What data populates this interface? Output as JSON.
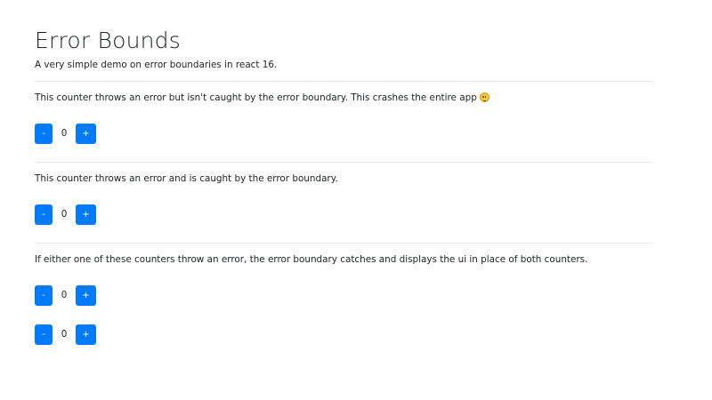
{
  "page": {
    "title": "Error Bounds",
    "subtitle": "A very simple demo on error boundaries in react 16."
  },
  "sections": [
    {
      "text": "This counter throws an error but isn't caught by the error boundary. This crashes the entire app",
      "emoji": "upside-down-face-icon",
      "counters": [
        {
          "decrement_label": "-",
          "value": "0",
          "increment_label": "+"
        }
      ]
    },
    {
      "text": "This counter throws an error and is caught by the error boundary.",
      "counters": [
        {
          "decrement_label": "-",
          "value": "0",
          "increment_label": "+"
        }
      ]
    },
    {
      "text": "If either one of these counters throw an error, the error boundary catches and displays the ui in place of both counters.",
      "counters": [
        {
          "decrement_label": "-",
          "value": "0",
          "increment_label": "+"
        },
        {
          "decrement_label": "-",
          "value": "0",
          "increment_label": "+"
        }
      ]
    }
  ],
  "colors": {
    "button_bg": "#007bff",
    "button_text": "#ffffff",
    "text": "#212529",
    "divider": "#e5e7eb"
  }
}
